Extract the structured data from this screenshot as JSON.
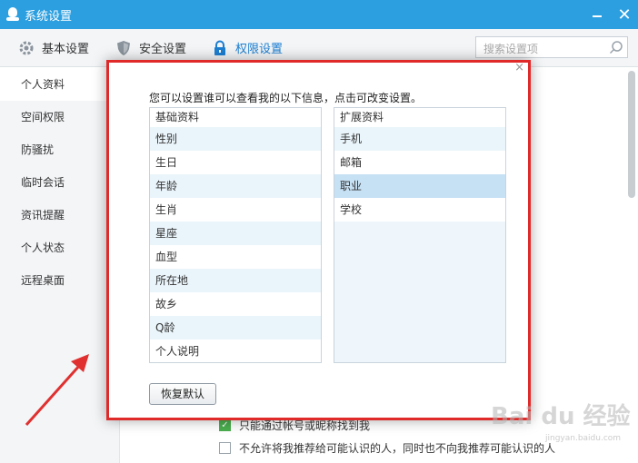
{
  "window": {
    "title": "系统设置"
  },
  "tabs": [
    {
      "label": "基本设置",
      "icon": "gear-icon"
    },
    {
      "label": "安全设置",
      "icon": "shield-icon"
    },
    {
      "label": "权限设置",
      "icon": "lock-icon"
    }
  ],
  "search": {
    "placeholder": "搜索设置项"
  },
  "sidebar": {
    "items": [
      "个人资料",
      "空间权限",
      "防骚扰",
      "临时会话",
      "资讯提醒",
      "个人状态",
      "远程桌面"
    ],
    "selected": "个人资料"
  },
  "background_options": [
    {
      "label": "只能通过帐号或昵称找到我",
      "checked": true
    },
    {
      "label": "不允许将我推荐给可能认识的人，同时也不向我推荐可能认识的人",
      "checked": false
    }
  ],
  "dialog": {
    "description": "您可以设置谁可以查看我的以下信息，点击可改变设置。",
    "basic_header": "基础资料",
    "basic_items": [
      "性别",
      "生日",
      "年龄",
      "生肖",
      "星座",
      "血型",
      "所在地",
      "故乡",
      "Q龄",
      "个人说明"
    ],
    "extended_header": "扩展资料",
    "extended_items": [
      "手机",
      "邮箱",
      "职业",
      "学校"
    ],
    "selected_extended": "职业",
    "reset_label": "恢复默认",
    "close_glyph": "×"
  },
  "watermark": {
    "text": "Bai du 经验",
    "sub": "jingyan.baidu.com"
  },
  "colors": {
    "titlebar": "#2b9fe0",
    "accent": "#1d7fd2",
    "highlight_border": "#e02a2a",
    "arrow": "#e03030"
  }
}
